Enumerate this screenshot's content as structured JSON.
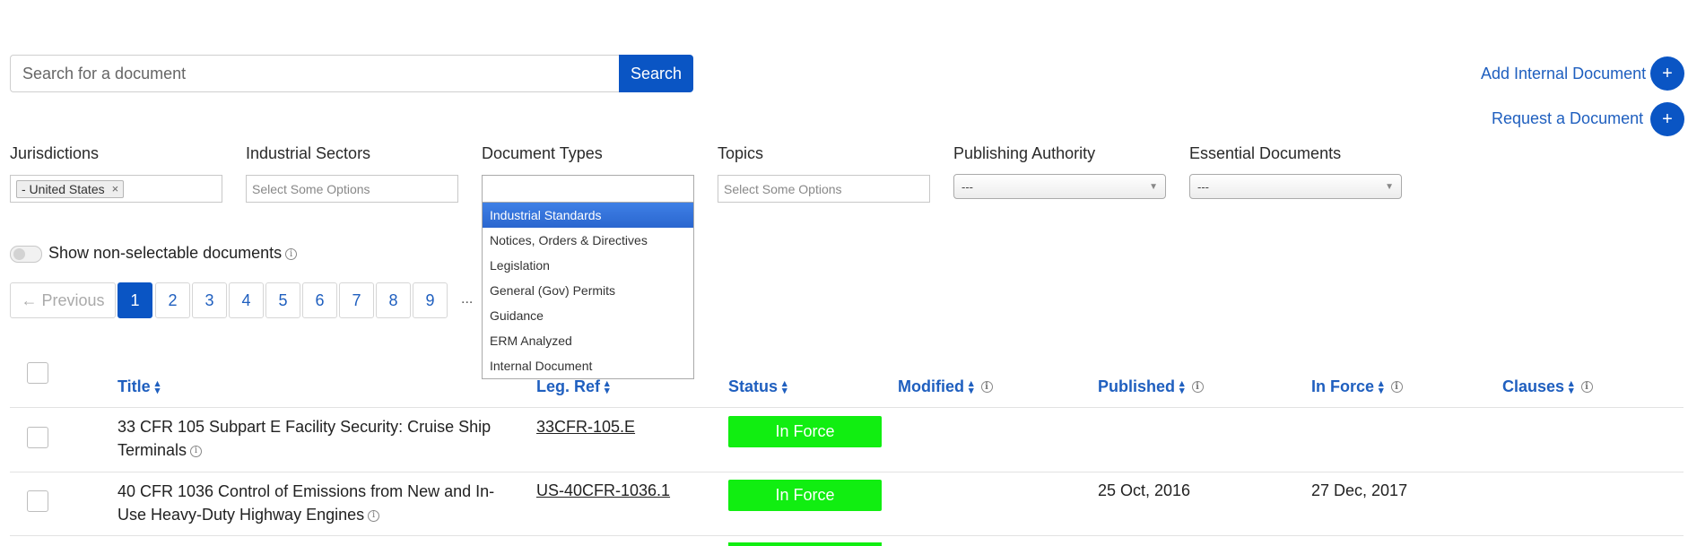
{
  "search": {
    "placeholder": "Search for a document",
    "button_label": "Search"
  },
  "actions": {
    "add_internal_label": "Add Internal Document",
    "request_label": "Request a Document",
    "plus_glyph": "+"
  },
  "filters": {
    "jurisdictions": {
      "label": "Jurisdictions",
      "chip": "- United States",
      "chip_remove": "×"
    },
    "industrial_sectors": {
      "label": "Industrial Sectors",
      "placeholder": "Select Some Options"
    },
    "document_types": {
      "label": "Document Types",
      "options": [
        "Industrial Standards",
        "Notices, Orders & Directives",
        "Legislation",
        "General (Gov) Permits",
        "Guidance",
        "ERM Analyzed",
        "Internal Document"
      ]
    },
    "topics": {
      "label": "Topics",
      "placeholder": "Select Some Options"
    },
    "publishing_authority": {
      "label": "Publishing Authority",
      "value": "---"
    },
    "essential_documents": {
      "label": "Essential Documents",
      "value": "---"
    }
  },
  "toggle": {
    "label": "Show non-selectable documents"
  },
  "info_glyph": "i",
  "pagination": {
    "previous": "← Previous",
    "pages": [
      "1",
      "2",
      "3",
      "4",
      "5",
      "6",
      "7",
      "8",
      "9"
    ],
    "ellipsis": "...",
    "current": "1"
  },
  "table": {
    "headers": {
      "title": "Title",
      "leg_ref": "Leg. Ref",
      "status": "Status",
      "modified": "Modified",
      "published": "Published",
      "in_force": "In Force",
      "clauses": "Clauses"
    },
    "rows": [
      {
        "title": "33 CFR 105 Subpart E Facility Security: Cruise Ship Terminals",
        "leg_ref": "33CFR-105.E",
        "status": "In Force",
        "modified": "",
        "published": "",
        "in_force": ""
      },
      {
        "title": "40 CFR 1036 Control of Emissions from New and In-Use Heavy-Duty Highway Engines",
        "leg_ref": "US-40CFR-1036.1",
        "status": "In Force",
        "modified": "",
        "published": "25 Oct, 2016",
        "in_force": "27 Dec, 2017"
      }
    ]
  },
  "colors": {
    "primary": "#0a55c4",
    "link": "#1f5fbf",
    "status_in_force": "#11ee11",
    "dropdown_highlight": "#3875d7"
  }
}
